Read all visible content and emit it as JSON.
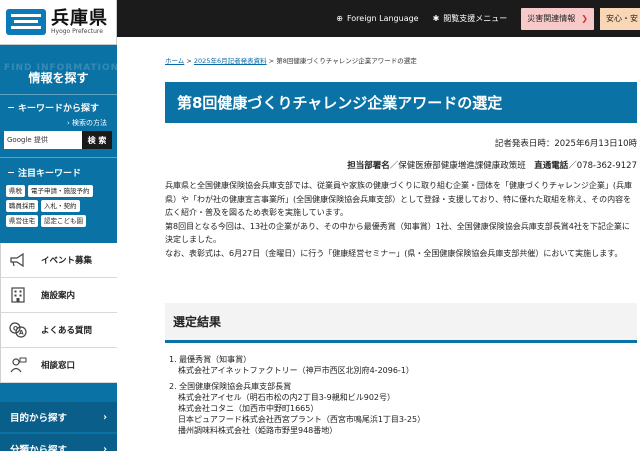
{
  "header": {
    "logo_name": "兵庫県",
    "logo_sub": "Hyogo Prefecture",
    "foreign_language": "Foreign Language",
    "reading_support": "閲覧支援メニュー",
    "disaster_info": "災害関連情報",
    "safety": "安心・安"
  },
  "sidebar": {
    "watermark": "FIND INFORMATION",
    "title": "情報を探す",
    "keyword_search": "キーワードから探す",
    "search_method": "検索の方法",
    "search_placeholder": "Google 提供",
    "search_button": "検 索",
    "hot_keywords": "注目キーワード",
    "keywords": [
      "県税",
      "電子申請・施設予約",
      "職員採用",
      "入札・契約",
      "県営住宅",
      "認定こども園"
    ],
    "menu": [
      {
        "label": "イベント募集",
        "icon": "megaphone-icon"
      },
      {
        "label": "施設案内",
        "icon": "building-icon"
      },
      {
        "label": "よくある質問",
        "icon": "qa-icon"
      },
      {
        "label": "相談窓口",
        "icon": "consult-icon"
      }
    ],
    "nav_purpose": "目的から探す",
    "nav_category": "分類から探す"
  },
  "main": {
    "breadcrumb": {
      "home": "ホーム",
      "sep1": " > ",
      "press": "2025年6月記者発表資料",
      "sep2": " > ",
      "current": "第8回健康づくりチャレンジ企業アワードの選定"
    },
    "title": "第8回健康づくりチャレンジ企業アワードの選定",
    "date": "記者発表日時：2025年6月13日10時",
    "dept_label": "担当部署名",
    "dept_value": "／保健医療部健康増進課健康政策班　",
    "phone_label": "直通電話",
    "phone_value": "／078-362-9127",
    "paragraphs": [
      "兵庫県と全国健康保険協会兵庫支部では、従業員や家族の健康づくりに取り組む企業・団体を「健康づくりチャレンジ企業」(兵庫県）や「わが社の健康宣言事業所」(全国健康保険協会兵庫支部）として登録・支援しており、特に優れた取組を称え、その内容を広く紹介・普及を図るため表彰を実施しています。",
      "第8回目となる今回は、13社の企業があり、その中から最優秀賞（知事賞）1社、全国健康保険協会兵庫支部長賞4社を下記企業に決定しました。",
      "なお、表彰式は、6月27日（金曜日）に行う「健康経営セミナー」(県・全国健康保険協会兵庫支部共催）において実施します。"
    ],
    "section_title": "選定結果",
    "results": [
      {
        "heading": "1. 最優秀賞（知事賞）",
        "items": [
          "株式会社アイネットファクトリー（神戸市西区北別府4-2096-1）"
        ]
      },
      {
        "heading": "2. 全国健康保険協会兵庫支部長賞",
        "items": [
          "株式会社アイセル（明石市松の内2丁目3-9親和ビル902号）",
          "株式会社コタニ（加西市中野町1665）",
          "日本ピュアフード株式会社西宮プラント（西宮市鳴尾浜1丁目3-25）",
          "播州調味料株式会社（姫路市野里948番地）"
        ]
      }
    ]
  }
}
